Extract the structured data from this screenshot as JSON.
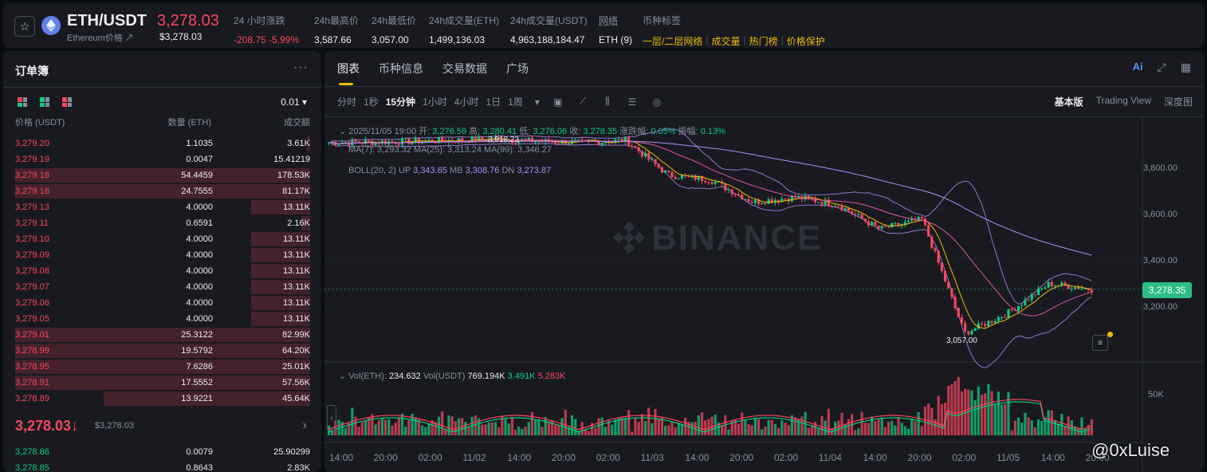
{
  "header": {
    "pair": "ETH/USDT",
    "subtitle": "Ethereum价格 ↗",
    "price": "3,278.03",
    "price_usd": "$3,278.03",
    "stats": [
      {
        "label": "24 小时涨跌",
        "value": "-208.75 -5.99%"
      },
      {
        "label": "24h最高价",
        "value": "3,587.66"
      },
      {
        "label": "24h最低价",
        "value": "3,057.00"
      },
      {
        "label": "24h成交量(ETH)",
        "value": "1,499,136.03"
      },
      {
        "label": "24h成交量(USDT)",
        "value": "4,963,188,184.47"
      },
      {
        "label": "网络",
        "value": "ETH (9)"
      }
    ],
    "tags_label": "币种标签",
    "tags": [
      "一层/二层网络",
      "成交量",
      "热门榜",
      "价格保护"
    ]
  },
  "orderbook": {
    "title": "订单簿",
    "more": "···",
    "tick": "0.01 ▾",
    "columns": [
      "价格 (USDT)",
      "数量 (ETH)",
      "成交额"
    ],
    "asks": [
      {
        "price": "3,279.20",
        "qty": "1.1035",
        "total": "3.61K",
        "depth": 0.01
      },
      {
        "price": "3,279.19",
        "qty": "0.0047",
        "total": "15.41219",
        "depth": 0.0
      },
      {
        "price": "3,279.18",
        "qty": "54.4459",
        "total": "178.53K",
        "depth": 1.0
      },
      {
        "price": "3,279.16",
        "qty": "24.7555",
        "total": "81.17K",
        "depth": 1.0
      },
      {
        "price": "3,279.13",
        "qty": "4.0000",
        "total": "13.11K",
        "depth": 0.2
      },
      {
        "price": "3,279.11",
        "qty": "0.6591",
        "total": "2.16K",
        "depth": 0.03
      },
      {
        "price": "3,279.10",
        "qty": "4.0000",
        "total": "13.11K",
        "depth": 0.2
      },
      {
        "price": "3,279.09",
        "qty": "4.0000",
        "total": "13.11K",
        "depth": 0.2
      },
      {
        "price": "3,279.08",
        "qty": "4.0000",
        "total": "13.11K",
        "depth": 0.2
      },
      {
        "price": "3,279.07",
        "qty": "4.0000",
        "total": "13.11K",
        "depth": 0.2
      },
      {
        "price": "3,279.06",
        "qty": "4.0000",
        "total": "13.11K",
        "depth": 0.2
      },
      {
        "price": "3,279.05",
        "qty": "4.0000",
        "total": "13.11K",
        "depth": 0.2
      },
      {
        "price": "3,279.01",
        "qty": "25.3122",
        "total": "82.99K",
        "depth": 1.0
      },
      {
        "price": "3,278.99",
        "qty": "19.5792",
        "total": "64.20K",
        "depth": 1.0
      },
      {
        "price": "3,278.95",
        "qty": "7.6286",
        "total": "25.01K",
        "depth": 1.0
      },
      {
        "price": "3,278.91",
        "qty": "17.5552",
        "total": "57.56K",
        "depth": 1.0
      },
      {
        "price": "3,278.89",
        "qty": "13.9221",
        "total": "45.64K",
        "depth": 0.7
      }
    ],
    "mid_price": "3,278.03↓",
    "mid_usd": "$3,278.03",
    "bids": [
      {
        "price": "3,278.86",
        "qty": "0.0079",
        "total": "25.90299",
        "depth": 0.0
      },
      {
        "price": "3,278.85",
        "qty": "0.8643",
        "total": "2.83K",
        "depth": 0.0
      }
    ]
  },
  "chart_panel": {
    "tabs": [
      "图表",
      "币种信息",
      "交易数据",
      "广场"
    ],
    "active_tab": "图表",
    "intervals": [
      "分时",
      "1秒",
      "15分钟",
      "1小时",
      "4小时",
      "1日",
      "1周"
    ],
    "active_interval": "15分钟",
    "views": [
      "基本版",
      "Trading View",
      "深度图"
    ],
    "active_view": "基本版",
    "ai_label": "Ai",
    "info": {
      "date": "2025/11/05 19:00",
      "open_label": "开:",
      "open": "3,276.59",
      "high_label": "高:",
      "high": "3,280.41",
      "low_label": "低:",
      "low": "3,276.06",
      "close_label": "收:",
      "close": "3,278.35",
      "chg_label": "涨跌幅:",
      "chg": "0.05%",
      "amp_label": "振幅:",
      "amp": "0.13%"
    },
    "ma_text": "MA(7): 3,293.32  MA(25): 3,313.24  MA(99): 3,346.27",
    "boll": {
      "label": "BOLL(20, 2)",
      "up_label": "UP",
      "up": "3,343.65",
      "mb_label": "MB",
      "mb": "3,308.76",
      "dn_label": "DN",
      "dn": "3,273.87"
    },
    "vol": {
      "label1": "Vol(ETH):",
      "v1": "234.632",
      "label2": "Vol(USDT)",
      "v2": "769.194K",
      "v3": "3.491K",
      "v4": "5.283K"
    },
    "price_axis": [
      "3,800.00",
      "3,600.00",
      "3,400.00",
      "3,200.00"
    ],
    "vol_axis": "50K",
    "current_price_tag": "3,278.35",
    "high_marker": "3,918.23",
    "low_marker": "3,057.00",
    "x_labels": [
      "14:00",
      "20:00",
      "02:00",
      "11/02",
      "14:00",
      "20:00",
      "02:00",
      "11/03",
      "14:00",
      "20:00",
      "02:00",
      "11/04",
      "14:00",
      "20:00",
      "02:00",
      "11/05",
      "14:00",
      "20:00"
    ],
    "watermark": "BINANCE",
    "handle": "@0xLuise",
    "colors": {
      "up": "#0ecb81",
      "down": "#f6465d",
      "accent": "#f0b90b",
      "ma7": "#f0b90b",
      "ma25": "#e052a0",
      "ma99": "#b289f5",
      "boll": "#b289f5"
    }
  },
  "chart_data": {
    "type": "line",
    "title": "",
    "xlabel": "",
    "ylabel": "",
    "ylim": [
      3000,
      3950
    ],
    "series": [
      {
        "name": "ETH/USDT",
        "x": [
          "11/01 14:00",
          "11/01 20:00",
          "11/02 02:00",
          "11/02 08:00",
          "11/02 14:00",
          "11/02 20:00",
          "11/03 02:00",
          "11/03 08:00",
          "11/03 14:00",
          "11/03 20:00",
          "11/04 02:00",
          "11/04 08:00",
          "11/04 14:00",
          "11/04 20:00",
          "11/05 02:00",
          "11/05 05:00",
          "11/05 08:00",
          "11/05 14:00",
          "11/05 19:00"
        ],
        "values": [
          3870,
          3872,
          3875,
          3880,
          3885,
          3875,
          3870,
          3880,
          3740,
          3720,
          3630,
          3650,
          3620,
          3520,
          3560,
          3100,
          3180,
          3300,
          3278
        ]
      }
    ]
  }
}
